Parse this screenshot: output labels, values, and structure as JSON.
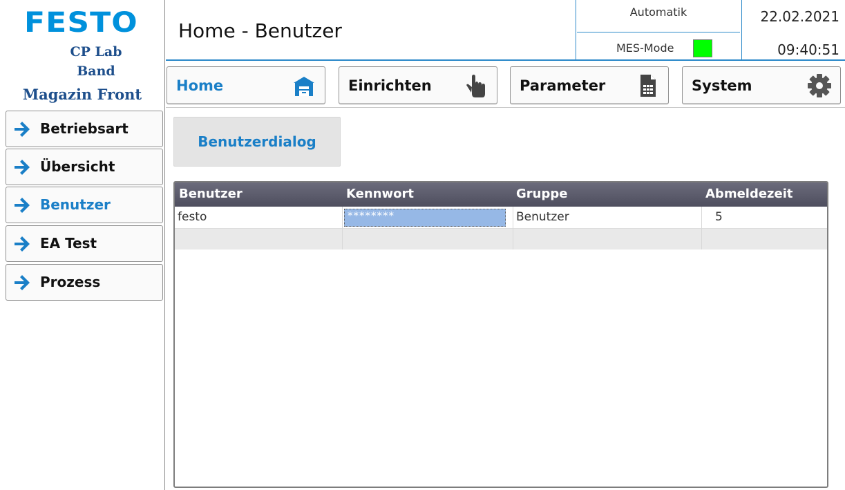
{
  "brand": {
    "logo": "FESTO",
    "station_name": "CP Lab",
    "station_sub": "Band",
    "station_module": "Magazin Front"
  },
  "header": {
    "title": "Home - Benutzer",
    "mode": "Automatik",
    "mes_label": "MES-Mode",
    "mes_status_color": "#00ff00",
    "date": "22.02.2021",
    "time": "09:40:51"
  },
  "nav": {
    "home": {
      "label": "Home",
      "icon": "house-icon"
    },
    "setup": {
      "label": "Einrichten",
      "icon": "hand-pointer-icon"
    },
    "parameter": {
      "label": "Parameter",
      "icon": "document-table-icon"
    },
    "system": {
      "label": "System",
      "icon": "gear-icon"
    }
  },
  "sidebar": {
    "items": [
      {
        "label": "Betriebsart",
        "icon": "arrow-right-icon"
      },
      {
        "label": "Übersicht",
        "icon": "arrow-right-icon"
      },
      {
        "label": "Benutzer",
        "icon": "arrow-right-icon",
        "active": true
      },
      {
        "label": "EA Test",
        "icon": "arrow-right-icon"
      },
      {
        "label": "Prozess",
        "icon": "arrow-right-icon"
      }
    ]
  },
  "dialog_button": {
    "label": "Benutzerdialog"
  },
  "table": {
    "columns": [
      "Benutzer",
      "Kennwort",
      "Gruppe",
      "Abmeldezeit"
    ],
    "rows": [
      {
        "user": "festo",
        "password": "********",
        "group": "Benutzer",
        "logout": "5"
      },
      {
        "user": "",
        "password": "",
        "group": "",
        "logout": ""
      }
    ]
  },
  "colors": {
    "accent": "#1a7fc7",
    "brand": "#0091dc",
    "station_text": "#1e4f8c",
    "header_line": "#2b88c9"
  }
}
